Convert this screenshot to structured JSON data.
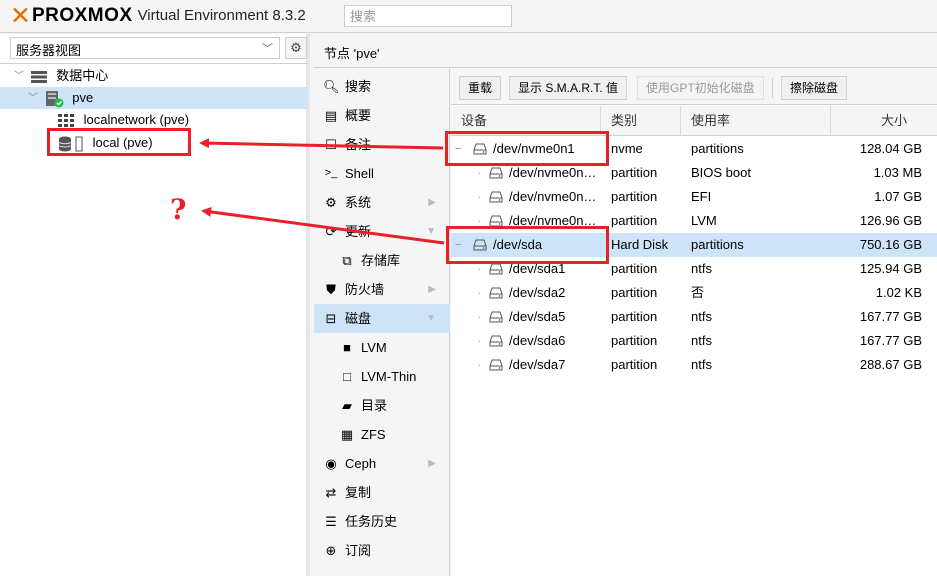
{
  "header": {
    "brand": "PROXMOX",
    "version": "Virtual Environment 8.3.2",
    "search_placeholder": "搜索"
  },
  "sidebar": {
    "view_select": "服务器视图",
    "tree": {
      "datacenter": "数据中心",
      "node": "pve",
      "storages": [
        "localnetwork (pve)",
        "local (pve)"
      ]
    }
  },
  "node_title": "节点 'pve'",
  "menu": {
    "items": [
      {
        "label": "搜索",
        "icon": "search-icon"
      },
      {
        "label": "概要",
        "icon": "summary-icon"
      },
      {
        "label": "备注",
        "icon": "notes-icon"
      },
      {
        "label": "Shell",
        "icon": "terminal-icon"
      },
      {
        "label": "系统",
        "icon": "gears-icon"
      },
      {
        "label": "更新",
        "icon": "refresh-icon"
      },
      {
        "label": "存储库",
        "icon": "repository-icon"
      },
      {
        "label": "防火墙",
        "icon": "shield-icon"
      },
      {
        "label": "磁盘",
        "icon": "hdd-icon"
      },
      {
        "label": "LVM",
        "icon": "square-icon"
      },
      {
        "label": "LVM-Thin",
        "icon": "square-outline-icon"
      },
      {
        "label": "目录",
        "icon": "folder-icon"
      },
      {
        "label": "ZFS",
        "icon": "th-large-icon"
      },
      {
        "label": "Ceph",
        "icon": "ceph-icon"
      },
      {
        "label": "复制",
        "icon": "retweet-icon"
      },
      {
        "label": "任务历史",
        "icon": "list-icon"
      },
      {
        "label": "订阅",
        "icon": "support-icon"
      }
    ]
  },
  "toolbar": {
    "reload": "重载",
    "smart": "显示 S.M.A.R.T. 值",
    "gpt": "使用GPT初始化磁盘",
    "wipe": "擦除磁盘"
  },
  "grid": {
    "columns": [
      "设备",
      "类别",
      "使用率",
      "大小"
    ],
    "rows": [
      {
        "device": "/dev/nvme0n1",
        "type": "nvme",
        "usage": "partitions",
        "size": "128.04 GB"
      },
      {
        "device": "/dev/nvme0n…",
        "type": "partition",
        "usage": "BIOS boot",
        "size": "1.03 MB"
      },
      {
        "device": "/dev/nvme0n…",
        "type": "partition",
        "usage": "EFI",
        "size": "1.07 GB"
      },
      {
        "device": "/dev/nvme0n…",
        "type": "partition",
        "usage": "LVM",
        "size": "126.96 GB"
      },
      {
        "device": "/dev/sda",
        "type": "Hard Disk",
        "usage": "partitions",
        "size": "750.16 GB"
      },
      {
        "device": "/dev/sda1",
        "type": "partition",
        "usage": "ntfs",
        "size": "125.94 GB"
      },
      {
        "device": "/dev/sda2",
        "type": "partition",
        "usage": "否",
        "size": "1.02 KB"
      },
      {
        "device": "/dev/sda5",
        "type": "partition",
        "usage": "ntfs",
        "size": "167.77 GB"
      },
      {
        "device": "/dev/sda6",
        "type": "partition",
        "usage": "ntfs",
        "size": "167.77 GB"
      },
      {
        "device": "/dev/sda7",
        "type": "partition",
        "usage": "ntfs",
        "size": "288.67 GB"
      }
    ]
  },
  "annotation": {
    "question": "?",
    "color": "#e8202a"
  },
  "colors": {
    "accent": "#e57000",
    "selection": "#cde3f7"
  }
}
